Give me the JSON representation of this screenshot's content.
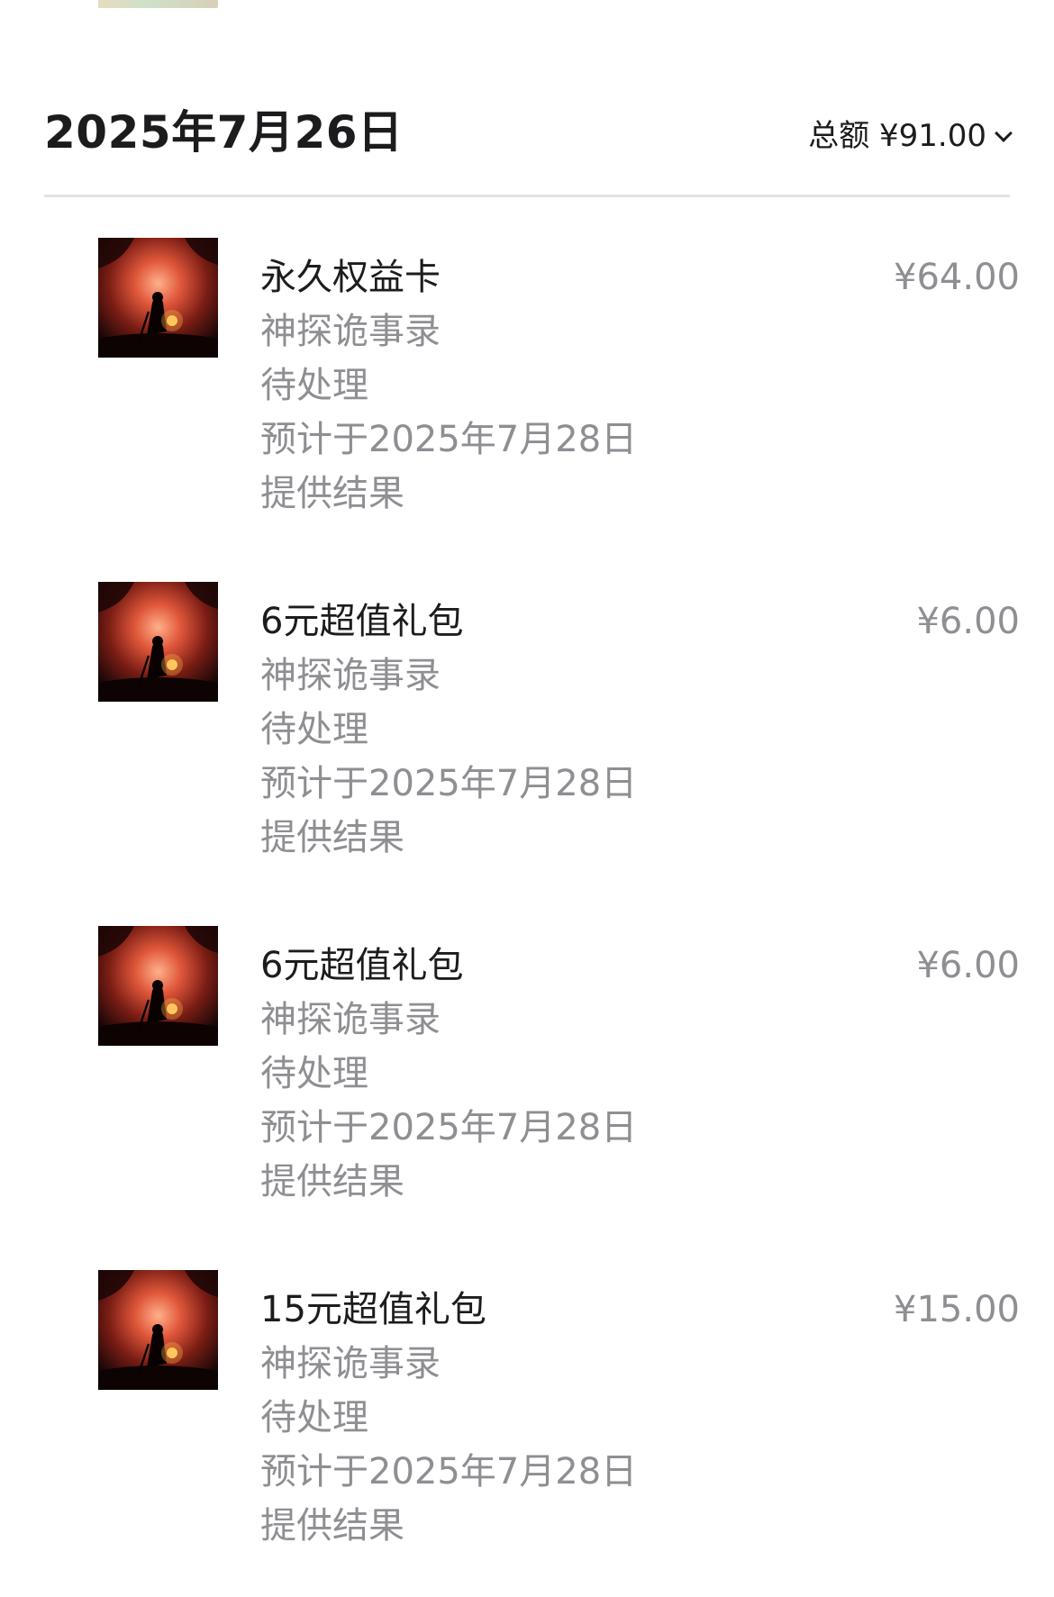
{
  "section": {
    "date": "2025年7月26日",
    "total": "总额 ¥91.00"
  },
  "items": [
    {
      "name": "永久权益卡",
      "app": "神探诡事录",
      "status": "待处理",
      "eta_line1": "预计于2025年7月28日",
      "eta_line2": "提供结果",
      "price": "¥64.00"
    },
    {
      "name": "6元超值礼包",
      "app": "神探诡事录",
      "status": "待处理",
      "eta_line1": "预计于2025年7月28日",
      "eta_line2": "提供结果",
      "price": "¥6.00"
    },
    {
      "name": "6元超值礼包",
      "app": "神探诡事录",
      "status": "待处理",
      "eta_line1": "预计于2025年7月28日",
      "eta_line2": "提供结果",
      "price": "¥6.00"
    },
    {
      "name": "15元超值礼包",
      "app": "神探诡事录",
      "status": "待处理",
      "eta_line1": "预计于2025年7月28日",
      "eta_line2": "提供结果",
      "price": "¥15.00"
    }
  ]
}
